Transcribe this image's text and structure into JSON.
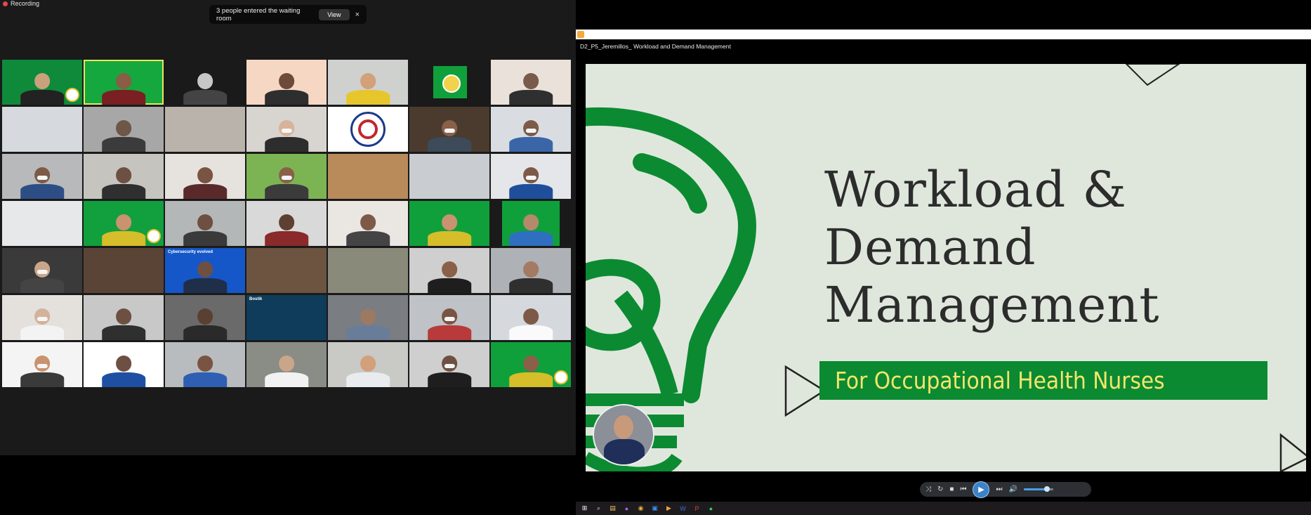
{
  "zoom": {
    "recording_label": "Recording",
    "toast": {
      "message": "3 people entered the waiting room",
      "view_label": "View",
      "close_glyph": "×"
    },
    "tiles": [
      {
        "bg": "#0e8a3a",
        "skin": "#c9a17d",
        "shirt": "#222",
        "label": "",
        "badge": true
      },
      {
        "bg": "#15a83e",
        "skin": "#8a5d45",
        "shirt": "#7a1f22",
        "speaking": true
      },
      {
        "bg": "#1a1a1a",
        "skin": "#c7c7c7",
        "shirt": "#444"
      },
      {
        "bg": "#f6d7c3",
        "skin": "#6d4a3a",
        "shirt": "#2e2e2e"
      },
      {
        "bg": "#cfd1cf",
        "skin": "#d2a07a",
        "shirt": "#e6c62b"
      },
      {
        "bg": "#1a1a1a",
        "skin": "",
        "shirt": "",
        "logo": "green"
      },
      {
        "bg": "#e9e1da",
        "skin": "#7a5a4a",
        "shirt": "#2f2f2f"
      },
      {
        "bg": "#d6d9dd",
        "skin": "",
        "shirt": ""
      },
      {
        "bg": "#a7a7a7",
        "skin": "#6e5648",
        "shirt": "#3b3b3b"
      },
      {
        "bg": "#b9b3ab",
        "skin": "",
        "shirt": ""
      },
      {
        "bg": "#d8d4cf",
        "skin": "#d6b39a",
        "shirt": "#2d2d2d",
        "mask": true
      },
      {
        "bg": "#ffffff",
        "skin": "",
        "shirt": "",
        "logo": "crest"
      },
      {
        "bg": "#4b3b2e",
        "skin": "#8a6048",
        "shirt": "#3c4a5a",
        "mask": true
      },
      {
        "bg": "#d9dde2",
        "skin": "#7c5b48",
        "shirt": "#3a66a8",
        "mask": true
      },
      {
        "bg": "#b7b9ba",
        "skin": "#7d5a47",
        "shirt": "#2d4d85",
        "mask": true
      },
      {
        "bg": "#c6c4bf",
        "skin": "#6e5042",
        "shirt": "#2f2f2f"
      },
      {
        "bg": "#e6e3de",
        "skin": "#7a5442",
        "shirt": "#5a2a2a"
      },
      {
        "bg": "#7cb454",
        "skin": "#8a6048",
        "shirt": "#3b3b3b",
        "mask": true
      },
      {
        "bg": "#b98a5a",
        "skin": "",
        "shirt": ""
      },
      {
        "bg": "#c9ccd1",
        "skin": "",
        "shirt": ""
      },
      {
        "bg": "#e4e6ea",
        "skin": "#7d5a47",
        "shirt": "#1f4f9a",
        "mask": true
      },
      {
        "bg": "#e7e8ea",
        "skin": "",
        "shirt": "#2f5fb3"
      },
      {
        "bg": "#11a03d",
        "skin": "#c9936f",
        "shirt": "#d6bd2a",
        "badge": true
      },
      {
        "bg": "#b4b7b7",
        "skin": "#6e5042",
        "shirt": "#3a3a3a"
      },
      {
        "bg": "#d9d9d9",
        "skin": "#5e4032",
        "shirt": "#8a2a2a"
      },
      {
        "bg": "#eae6e1",
        "skin": "#7d5a47",
        "shirt": "#444"
      },
      {
        "bg": "#10a03b",
        "skin": "#c9936f",
        "shirt": "#d6bd2a"
      },
      {
        "bg": "#1a1a1a",
        "skin": "#b48a6a",
        "shirt": "#2f6fbf",
        "logo": "portrait"
      },
      {
        "bg": "#3a3a3a",
        "skin": "#c9a58a",
        "shirt": "#444",
        "mask": true
      },
      {
        "bg": "#5a4436",
        "skin": "",
        "shirt": ""
      },
      {
        "bg": "#1557c8",
        "skin": "#6e5042",
        "shirt": "#1f2f4a",
        "label": "Cybersecurity evolved"
      },
      {
        "bg": "#6c5440",
        "skin": "",
        "shirt": ""
      },
      {
        "bg": "#8a8a7a",
        "skin": "",
        "shirt": ""
      },
      {
        "bg": "#cfcfcf",
        "skin": "#8a6048",
        "shirt": "#1e1e1e"
      },
      {
        "bg": "#aeb1b5",
        "skin": "#a37b62",
        "shirt": "#2f2f2f"
      },
      {
        "bg": "#e4e0dc",
        "skin": "#d2b29a",
        "shirt": "#f3f3f3",
        "mask": true
      },
      {
        "bg": "#c8c8c8",
        "skin": "#6e5042",
        "shirt": "#2f2f2f"
      },
      {
        "bg": "#6a6a6a",
        "skin": "#5a4032",
        "shirt": "#2a2a2a"
      },
      {
        "bg": "#0f3c5a",
        "skin": "",
        "shirt": "",
        "label": "Bostik"
      },
      {
        "bg": "#7a7d82",
        "skin": "#9c7a62",
        "shirt": "#6a7d98"
      },
      {
        "bg": "#bfc2c6",
        "skin": "#7a5442",
        "shirt": "#b83a3a",
        "mask": true
      },
      {
        "bg": "#d5d9de",
        "skin": "#7d5a47",
        "shirt": "#fafafa"
      },
      {
        "bg": "#f4f4f4",
        "skin": "#c9936f",
        "shirt": "#3a3a3a",
        "mask": true
      },
      {
        "bg": "#ffffff",
        "skin": "#6e5042",
        "shirt": "#1f4fa3"
      },
      {
        "bg": "#b8bcbf",
        "skin": "#7a5442",
        "shirt": "#2f5fb3"
      },
      {
        "bg": "#8a8c86",
        "skin": "#c9a58a",
        "shirt": "#f2f2f2"
      },
      {
        "bg": "#c9c9c5",
        "skin": "#d2a07a",
        "shirt": "#e9ecef"
      },
      {
        "bg": "#cfcfcf",
        "skin": "#6e5042",
        "shirt": "#1e1e1e",
        "mask": true
      },
      {
        "bg": "#10a03b",
        "skin": "#8a6048",
        "shirt": "#d6bd2a",
        "badge": true
      }
    ]
  },
  "player": {
    "filename": "D2_P5_Jeremillos_ Workload and Demand Management",
    "slide": {
      "title_lines": [
        "Workload &",
        "Demand",
        "Management"
      ],
      "subtitle": "For Occupational Health Nurses",
      "accent": "#0b8a32",
      "subtitle_color": "#f5e56b"
    },
    "controls": {
      "shuffle_icon": "⤨",
      "repeat_icon": "↻",
      "stop_icon": "■",
      "prev_icon": "⏮",
      "play_icon": "▶",
      "next_icon": "⏭",
      "volume_icon": "🔊",
      "volume_level": 0.8
    }
  },
  "taskbar": {
    "icons": [
      {
        "name": "windows-start-icon",
        "color": "#ffffff",
        "glyph": "⊞"
      },
      {
        "name": "search-icon",
        "color": "#dddddd",
        "glyph": "⌕"
      },
      {
        "name": "file-explorer-icon",
        "color": "#f0c35a",
        "glyph": "▤"
      },
      {
        "name": "messenger-icon",
        "color": "#b55cf0",
        "glyph": "●"
      },
      {
        "name": "chrome-icon",
        "color": "#e6b23a",
        "glyph": "◉"
      },
      {
        "name": "zoom-icon",
        "color": "#3a8ef0",
        "glyph": "▣"
      },
      {
        "name": "media-player-icon",
        "color": "#f0a13a",
        "glyph": "▶"
      },
      {
        "name": "word-icon",
        "color": "#3a6ae0",
        "glyph": "W"
      },
      {
        "name": "pdf-icon",
        "color": "#e0403a",
        "glyph": "P"
      },
      {
        "name": "spotify-icon",
        "color": "#1ed760",
        "glyph": "●"
      }
    ]
  }
}
